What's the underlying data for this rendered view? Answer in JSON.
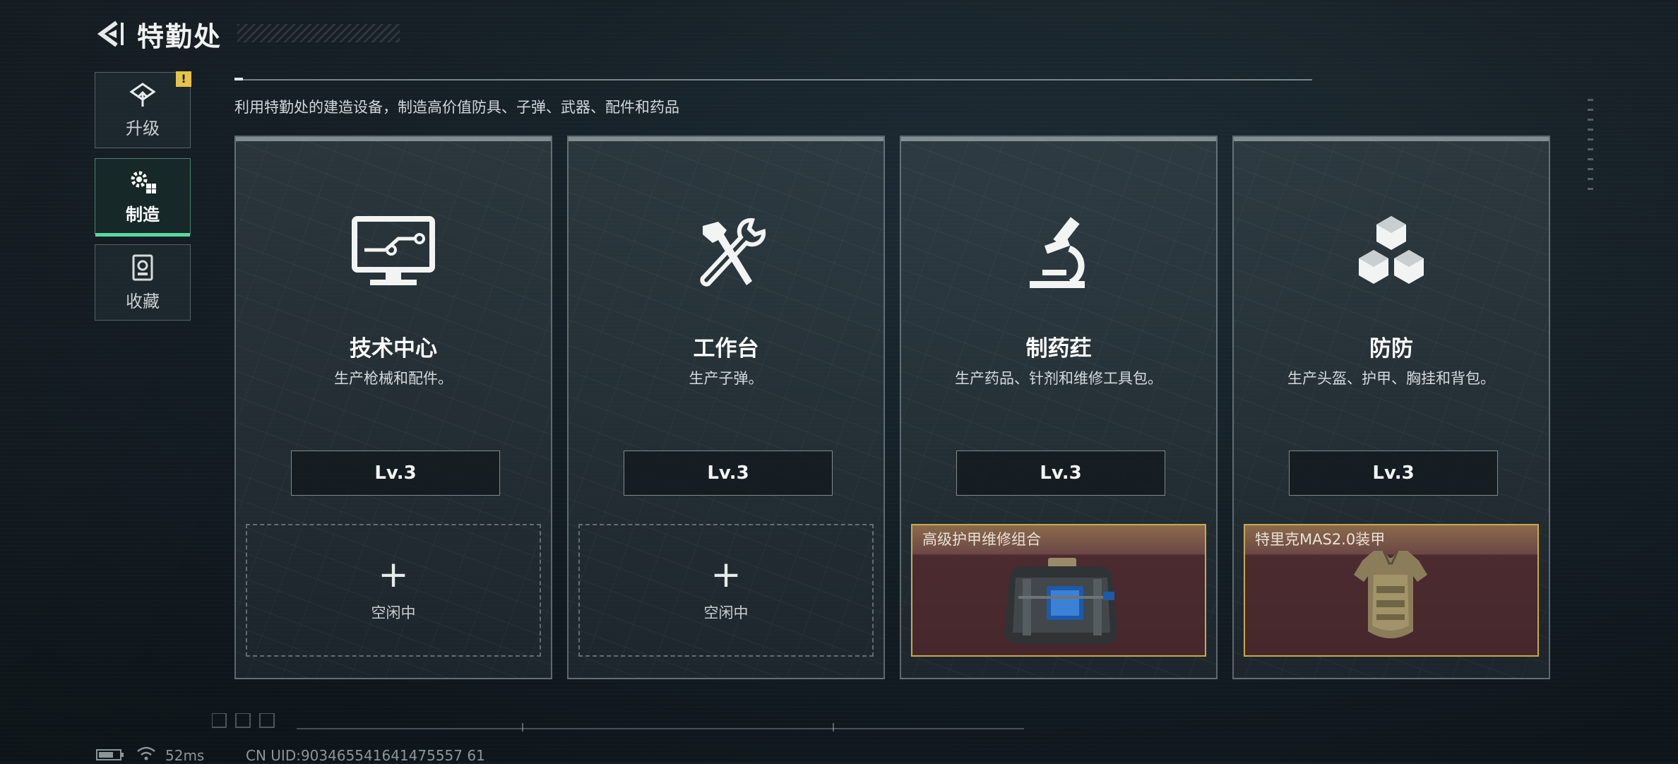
{
  "header": {
    "back_icon": "back-arrow-icon",
    "title": "特勤处"
  },
  "sidebar": {
    "items": [
      {
        "label": "升级",
        "icon": "upgrade-icon",
        "badge": "!"
      },
      {
        "label": "制造",
        "icon": "gears-icon",
        "active": true
      },
      {
        "label": "收藏",
        "icon": "collection-icon"
      }
    ]
  },
  "description": "利用特勤处的建造设备，制造高价值防具、子弹、武器、配件和药品",
  "stations": [
    {
      "name": "技术中心",
      "subtitle": "生产枪械和配件。",
      "level": "Lv.3",
      "icon": "monitor-circuit-icon",
      "slot": {
        "state": "idle",
        "status": "空闲中"
      }
    },
    {
      "name": "工作台",
      "subtitle": "生产子弹。",
      "level": "Lv.3",
      "icon": "hammer-wrench-icon",
      "slot": {
        "state": "idle",
        "status": "空闲中"
      }
    },
    {
      "name": "制药荭",
      "subtitle": "生产药品、针剂和维修工具包。",
      "level": "Lv.3",
      "icon": "microscope-icon",
      "slot": {
        "state": "producing",
        "item_name": "高级护甲维修组合",
        "item_icon": "repair-kit-bag-icon"
      }
    },
    {
      "name": "防防",
      "subtitle": "生产头盔、护甲、胸挂和背包。",
      "level": "Lv.3",
      "icon": "cubes-icon",
      "slot": {
        "state": "producing",
        "item_name": "特里克MAS2.0装甲",
        "item_icon": "body-armor-icon"
      }
    }
  ],
  "status_bar": {
    "ping": "52ms",
    "uid": "CN UID:903465541641475557 61"
  },
  "colors": {
    "accent": "#58d9a0",
    "warning": "#e6c34a",
    "item_border": "#c9a94f"
  }
}
